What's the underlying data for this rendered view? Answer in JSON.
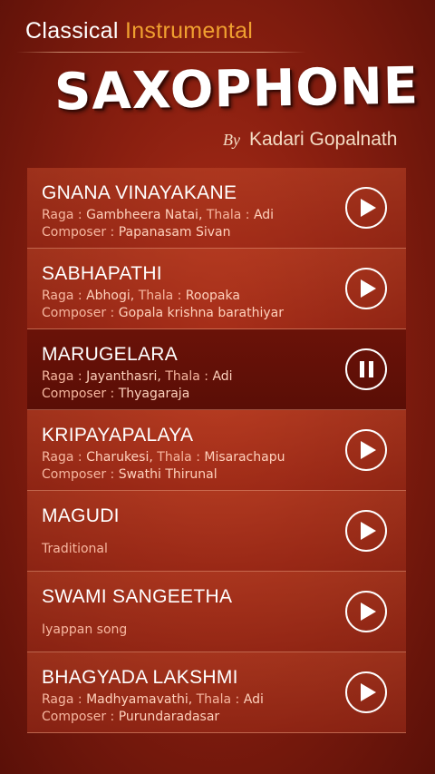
{
  "header": {
    "top_word1": "Classical",
    "top_word2": "Instrumental",
    "title": "SAXOPHONE",
    "by": "By",
    "artist": "Kadari Gopalnath"
  },
  "labels": {
    "raga": "Raga",
    "thala": "Thala",
    "composer": "Composer",
    "sep": " : "
  },
  "tracks": [
    {
      "name": "GNANA VINAYAKANE",
      "raga": "Gambheera Natai",
      "thala": "Adi",
      "composer": "Papanasam Sivan",
      "state": "play"
    },
    {
      "name": "SABHAPATHI",
      "raga": "Abhogi",
      "thala": "Roopaka",
      "composer": "Gopala krishna barathiyar",
      "state": "play"
    },
    {
      "name": "MARUGELARA",
      "raga": "Jayanthasri",
      "thala": "Adi",
      "composer": "Thyagaraja",
      "state": "pause"
    },
    {
      "name": "KRIPAYAPALAYA",
      "raga": "Charukesi",
      "thala": "Misarachapu",
      "composer": "Swathi Thirunal",
      "state": "play"
    },
    {
      "name": "MAGUDI",
      "note": "Traditional",
      "state": "play"
    },
    {
      "name": "SWAMI SANGEETHA",
      "note": "Iyappan song",
      "state": "play"
    },
    {
      "name": "BHAGYADA LAKSHMI",
      "raga": "Madhyamavathi",
      "thala": "Adi",
      "composer": "Purundaradasar",
      "state": "play"
    }
  ],
  "icons": {
    "play": "play-icon",
    "pause": "pause-icon"
  },
  "colors": {
    "accent": "#f0a030",
    "active_row": "#5a0e06"
  }
}
